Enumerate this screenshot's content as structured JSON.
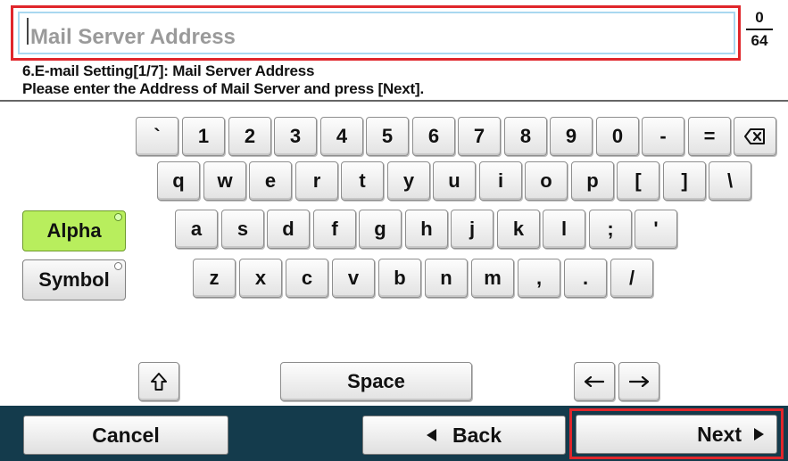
{
  "input": {
    "placeholder": "Mail Server Address",
    "value": "",
    "char_count": "0",
    "char_max": "64"
  },
  "instructions": {
    "line1": "6.E-mail Setting[1/7]: Mail Server Address",
    "line2": "Please enter the Address of Mail Server and press [Next]."
  },
  "keyboard": {
    "row1": [
      "`",
      "1",
      "2",
      "3",
      "4",
      "5",
      "6",
      "7",
      "8",
      "9",
      "0",
      "-",
      "="
    ],
    "row2": [
      "q",
      "w",
      "e",
      "r",
      "t",
      "y",
      "u",
      "i",
      "o",
      "p",
      "[",
      "]",
      "\\"
    ],
    "row3": [
      "a",
      "s",
      "d",
      "f",
      "g",
      "h",
      "j",
      "k",
      "l",
      ";",
      "'"
    ],
    "row4": [
      "z",
      "x",
      "c",
      "v",
      "b",
      "n",
      "m",
      ",",
      ".",
      "/"
    ],
    "backspace_icon": "backspace-icon",
    "shift_icon": "shift-arrow-up-icon",
    "space_label": "Space",
    "arrow_left_icon": "arrow-left-icon",
    "arrow_right_icon": "arrow-right-icon"
  },
  "modes": {
    "alpha_label": "Alpha",
    "symbol_label": "Symbol",
    "active_color": "#b8ee5d"
  },
  "bottom": {
    "cancel_label": "Cancel",
    "back_label": "Back",
    "next_label": "Next",
    "bar_color": "#143b4c",
    "highlight_color": "#e0262b"
  }
}
